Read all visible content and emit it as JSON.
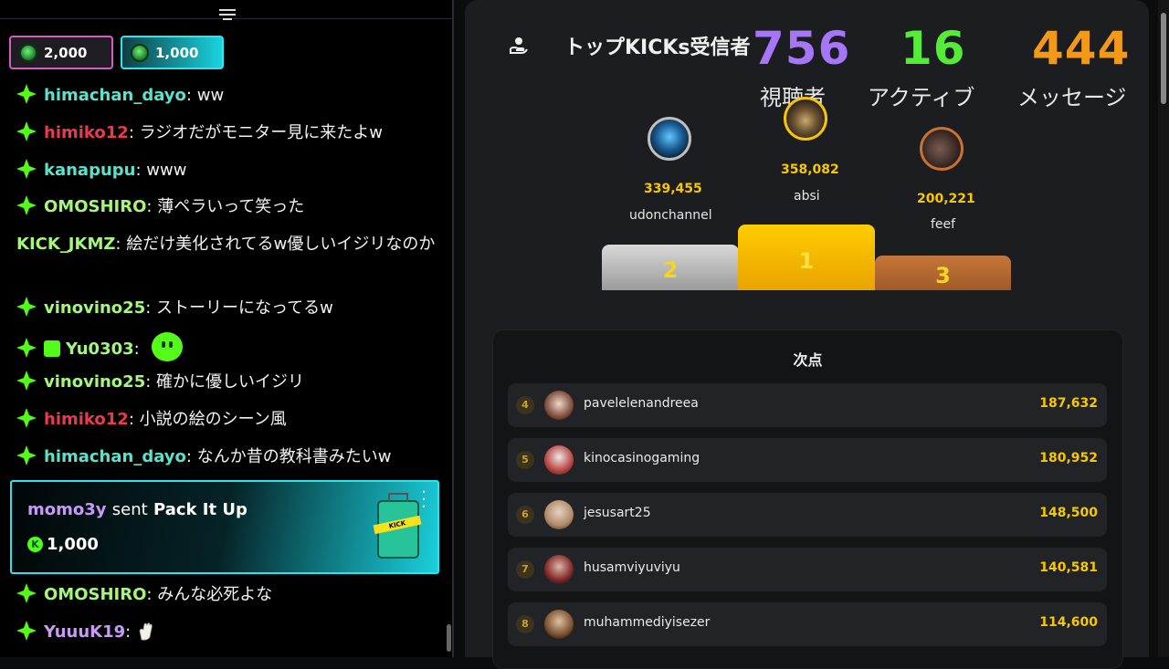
{
  "chat": {
    "pinned": [
      {
        "amount": "2,000"
      },
      {
        "amount": "1,000"
      }
    ],
    "messages": [
      {
        "user": "himachan_dayo",
        "text": "ww",
        "color": "#5ee0ca"
      },
      {
        "user": "himiko12",
        "text": "ラジオだがモニター見に来たよw",
        "color": "#ea3b4e"
      },
      {
        "user": "kanapupu",
        "text": "www",
        "color": "#5ee0ca"
      },
      {
        "user": "OMOSHIRO",
        "text": "薄ペラいって笑った",
        "color": "#a4f77c"
      },
      {
        "user": "KICK_JKMZ",
        "text": "絵だけ美化されてるw優しいイジリなのか",
        "color": "#a4f77c"
      },
      {
        "user": "vinovino25",
        "text": "ストーリーになってるw",
        "color": "#a4f77c"
      },
      {
        "user": "Yu0303",
        "text": "",
        "color": "#a4f77c"
      },
      {
        "user": "vinovino25",
        "text": "確かに優しいイジリ",
        "color": "#a4f77c"
      },
      {
        "user": "himiko12",
        "text": "小説の絵のシーン風",
        "color": "#ea3b4e"
      },
      {
        "user": "himachan_dayo",
        "text": "なんか昔の教科書みたいw",
        "color": "#5ee0ca"
      },
      {
        "user": "OMOSHIRO",
        "text": "みんな必死よな",
        "color": "#a4f77c"
      },
      {
        "user": "YuuuK19",
        "text": "",
        "color": "#c79af9"
      }
    ],
    "gift": {
      "sender": "momo3y",
      "sent": "sent",
      "item": "Pack It Up",
      "amount": "1,000",
      "suitcase_label": "KICK"
    }
  },
  "leaderboard": {
    "title": "トップKICKs受信者",
    "stats": {
      "viewers": {
        "value": "756",
        "label": "視聴者"
      },
      "active": {
        "value": "16",
        "label": "アクティブ"
      },
      "messages": {
        "value": "444",
        "label": "メッセージ"
      }
    },
    "podium": [
      {
        "rank": "2",
        "name": "udonchannel",
        "score": "339,455"
      },
      {
        "rank": "1",
        "name": "absi",
        "score": "358,082"
      },
      {
        "rank": "3",
        "name": "feef",
        "score": "200,221"
      }
    ],
    "runners_title": "次点",
    "runners": [
      {
        "rank": "4",
        "name": "pavelelenandreea",
        "score": "187,632"
      },
      {
        "rank": "5",
        "name": "kinocasinogaming",
        "score": "180,952"
      },
      {
        "rank": "6",
        "name": "jesusart25",
        "score": "148,500"
      },
      {
        "rank": "7",
        "name": "husamviyuviyu",
        "score": "140,581"
      },
      {
        "rank": "8",
        "name": "muhammediyisezer",
        "score": "114,600"
      }
    ]
  }
}
